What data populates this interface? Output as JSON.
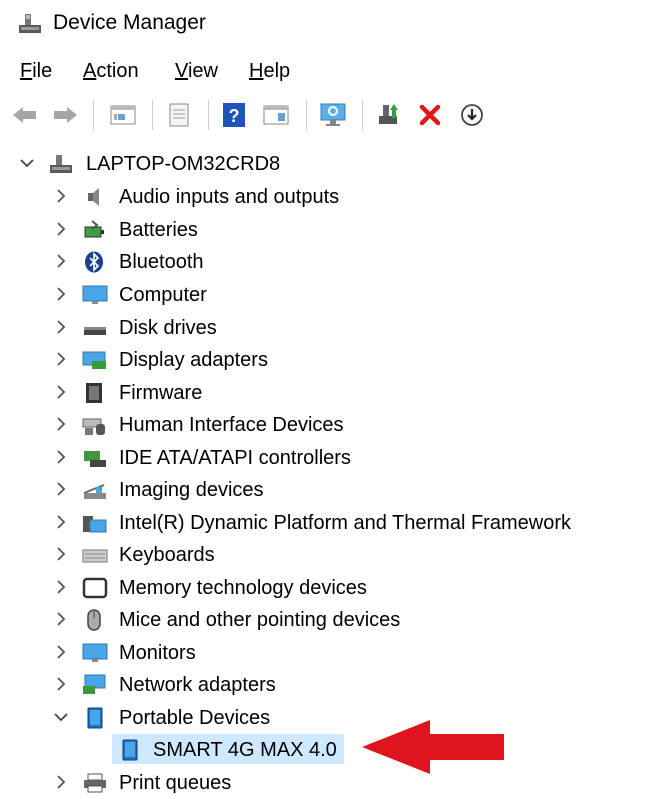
{
  "window": {
    "title": "Device Manager"
  },
  "menu": [
    {
      "prefix": "",
      "underline": "F",
      "rest": "ile"
    },
    {
      "prefix": "",
      "underline": "A",
      "rest": "ction"
    },
    {
      "prefix": "",
      "underline": "V",
      "rest": "iew"
    },
    {
      "prefix": "",
      "underline": "H",
      "rest": "elp"
    }
  ],
  "toolbar": {
    "icons": [
      "back-arrow-icon",
      "forward-arrow-icon",
      "properties-icon",
      "update-list-icon",
      "help-icon",
      "action-pane-icon",
      "monitor-scan-icon",
      "add-driver-icon",
      "uninstall-icon",
      "download-icon"
    ]
  },
  "tree": {
    "root": "LAPTOP-OM32CRD8",
    "categories": [
      "Audio inputs and outputs",
      "Batteries",
      "Bluetooth",
      "Computer",
      "Disk drives",
      "Display adapters",
      "Firmware",
      "Human Interface Devices",
      "IDE ATA/ATAPI controllers",
      "Imaging devices",
      "Intel(R) Dynamic Platform and Thermal Framework",
      "Keyboards",
      "Memory technology devices",
      "Mice and other pointing devices",
      "Monitors",
      "Network adapters",
      "Portable Devices",
      "Print queues"
    ],
    "expanded_child": "SMART 4G MAX 4.0"
  },
  "colors": {
    "selection": "#cde8ff",
    "annotation_arrow": "#e0141e",
    "uninstall_x": "#e01818"
  }
}
